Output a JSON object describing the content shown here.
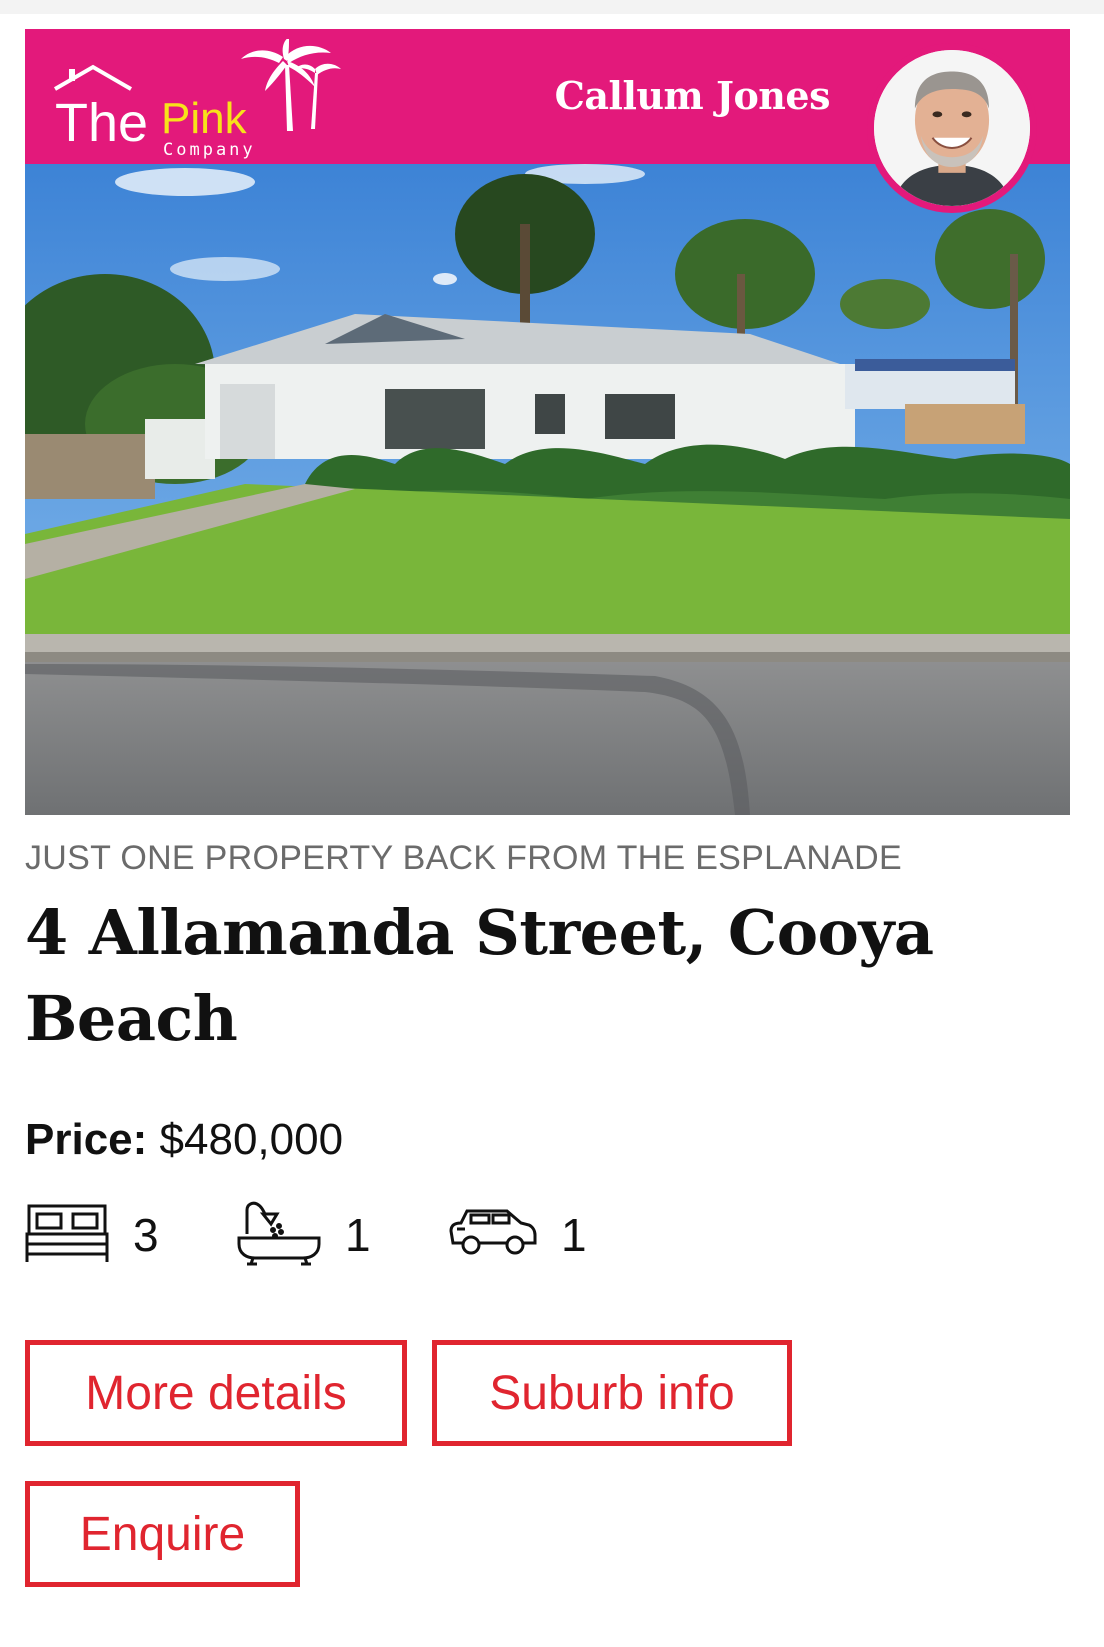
{
  "brand": {
    "logo_text_the": "The",
    "logo_text_pink": "Pink",
    "logo_text_company": "Company",
    "color": "#e3197b",
    "accent_yellow": "#f7e21a"
  },
  "agent": {
    "name": "Callum Jones"
  },
  "listing": {
    "tagline": "JUST ONE PROPERTY BACK FROM THE ESPLANADE",
    "address": "4 Allamanda Street, Cooya Beach",
    "price_label": "Price:",
    "price_value": "$480,000",
    "bedrooms": "3",
    "bathrooms": "1",
    "parking": "1",
    "icons": [
      "bed-icon",
      "bath-icon",
      "car-icon"
    ]
  },
  "actions": {
    "more_details": "More details",
    "suburb_info": "Suburb info",
    "enquire": "Enquire",
    "color": "#e0252f"
  }
}
